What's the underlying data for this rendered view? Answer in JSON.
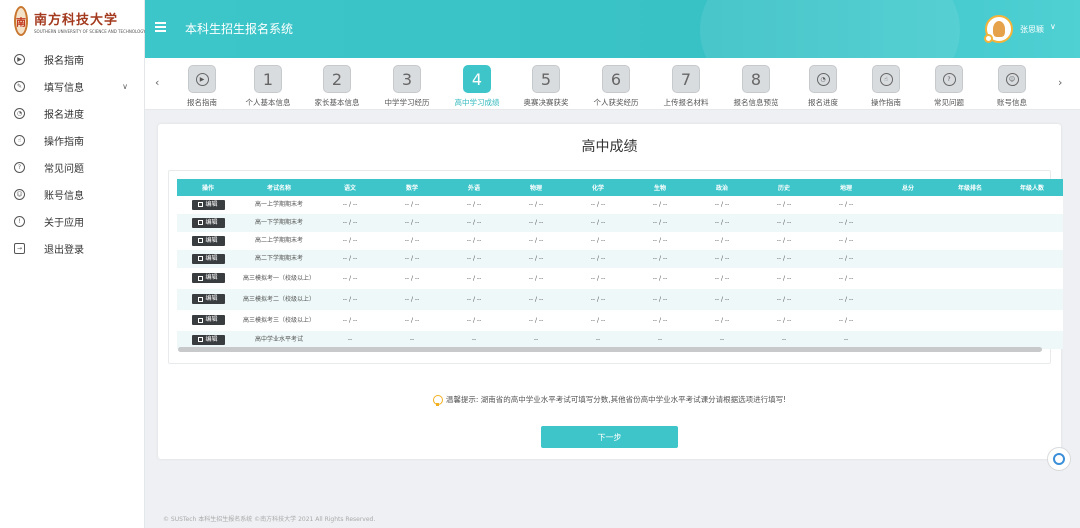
{
  "logo": {
    "seal": "南",
    "name_cn": "南方科技大学",
    "name_en": "SOUTHERN UNIVERSITY OF SCIENCE AND TECHNOLOGY"
  },
  "header": {
    "title": "本科生招生报名系统",
    "user_name": "张思颖"
  },
  "sidebar": {
    "items": [
      {
        "label": "报名指南",
        "icon": "play-circle-icon"
      },
      {
        "label": "填写信息",
        "icon": "edit-circle-icon",
        "has_arrow": true
      },
      {
        "label": "报名进度",
        "icon": "gauge-icon"
      },
      {
        "label": "操作指南",
        "icon": "pointer-icon"
      },
      {
        "label": "常见问题",
        "icon": "question-icon"
      },
      {
        "label": "账号信息",
        "icon": "user-icon"
      },
      {
        "label": "关于应用",
        "icon": "info-icon"
      },
      {
        "label": "退出登录",
        "icon": "logout-icon"
      }
    ]
  },
  "steps": [
    {
      "label": "报名指南",
      "icon": "play-circle-icon"
    },
    {
      "label": "个人基本信息",
      "num": "1"
    },
    {
      "label": "家长基本信息",
      "num": "2"
    },
    {
      "label": "中学学习经历",
      "num": "3"
    },
    {
      "label": "高中学习成绩",
      "num": "4",
      "active": true
    },
    {
      "label": "奥赛决赛获奖",
      "num": "5"
    },
    {
      "label": "个人获奖经历",
      "num": "6"
    },
    {
      "label": "上传报名材料",
      "num": "7"
    },
    {
      "label": "报名信息预览",
      "num": "8"
    },
    {
      "label": "报名进度",
      "icon": "gauge-icon"
    },
    {
      "label": "操作指南",
      "icon": "pointer-icon"
    },
    {
      "label": "常见问题",
      "icon": "question-icon"
    },
    {
      "label": "账号信息",
      "icon": "user-icon"
    }
  ],
  "card": {
    "title": "高中成绩"
  },
  "table": {
    "headers": [
      "操作",
      "考试名称",
      "语文",
      "数学",
      "外语",
      "物理",
      "化学",
      "生物",
      "政治",
      "历史",
      "地理",
      "总分",
      "年级排名",
      "年级人数"
    ],
    "edit_label": "编辑",
    "rows": [
      {
        "name": "高一上学期期末考",
        "cells": [
          "-- / --",
          "-- / --",
          "-- / --",
          "-- / --",
          "-- / --",
          "-- / --",
          "-- / --",
          "-- / --",
          "-- / --",
          "",
          "",
          ""
        ]
      },
      {
        "name": "高一下学期期末考",
        "cells": [
          "-- / --",
          "-- / --",
          "-- / --",
          "-- / --",
          "-- / --",
          "-- / --",
          "-- / --",
          "-- / --",
          "-- / --",
          "",
          "",
          ""
        ]
      },
      {
        "name": "高二上学期期末考",
        "cells": [
          "-- / --",
          "-- / --",
          "-- / --",
          "-- / --",
          "-- / --",
          "-- / --",
          "-- / --",
          "-- / --",
          "-- / --",
          "",
          "",
          ""
        ]
      },
      {
        "name": "高二下学期期末考",
        "cells": [
          "-- / --",
          "-- / --",
          "-- / --",
          "-- / --",
          "-- / --",
          "-- / --",
          "-- / --",
          "-- / --",
          "-- / --",
          "",
          "",
          ""
        ]
      },
      {
        "name": "高三模拟考一（校级以上）",
        "cells": [
          "-- / --",
          "-- / --",
          "-- / --",
          "-- / --",
          "-- / --",
          "-- / --",
          "-- / --",
          "-- / --",
          "-- / --",
          "",
          "",
          ""
        ]
      },
      {
        "name": "高三模拟考二（校级以上）",
        "cells": [
          "-- / --",
          "-- / --",
          "-- / --",
          "-- / --",
          "-- / --",
          "-- / --",
          "-- / --",
          "-- / --",
          "-- / --",
          "",
          "",
          ""
        ]
      },
      {
        "name": "高三模拟考三（校级以上）",
        "cells": [
          "-- / --",
          "-- / --",
          "-- / --",
          "-- / --",
          "-- / --",
          "-- / --",
          "-- / --",
          "-- / --",
          "-- / --",
          "",
          "",
          ""
        ]
      },
      {
        "name": "高中学业水平考试",
        "cells": [
          "--",
          "--",
          "--",
          "--",
          "--",
          "--",
          "--",
          "--",
          "--",
          "",
          "",
          ""
        ]
      }
    ]
  },
  "tip": "温馨提示: 湖南省的高中学业水平考试可填写分数,其他省份高中学业水平考试课分请根据选项进行填写!",
  "next_button": "下一步",
  "footer": "© SUSTech 本科生招生报名系统 ©南方科技大学 2021 All Rights Reserved.",
  "colors": {
    "accent": "#3ec5c9",
    "edit_button": "#3a3d40"
  }
}
